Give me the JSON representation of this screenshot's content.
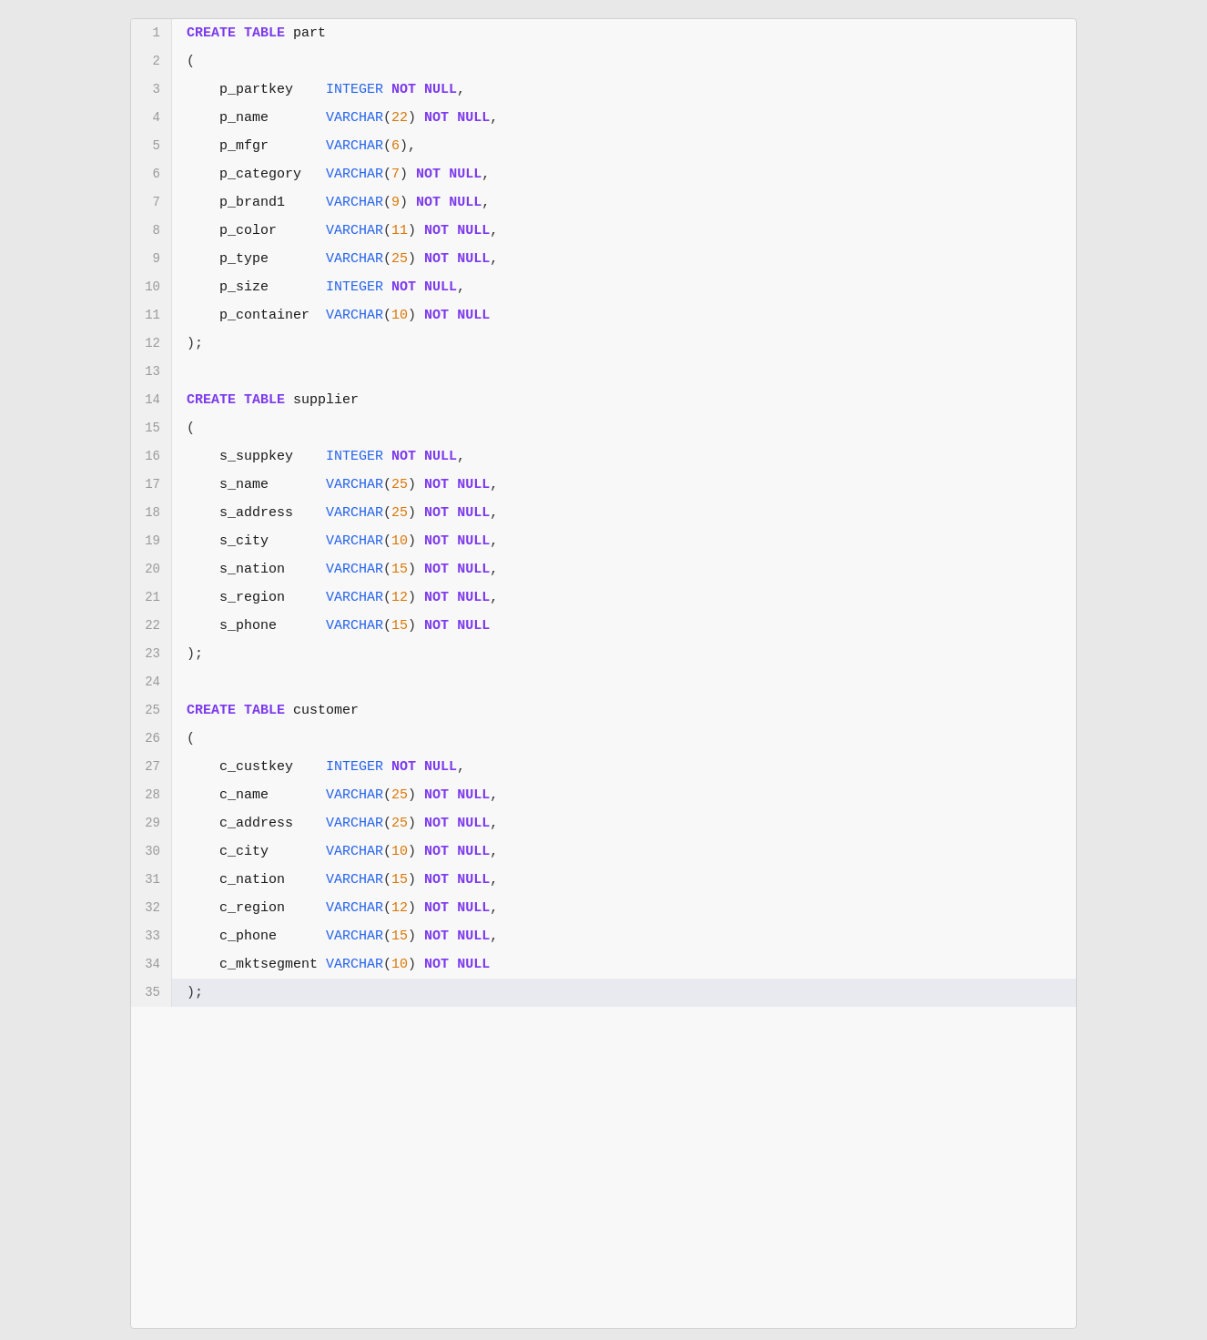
{
  "editor": {
    "lines": [
      {
        "num": 1,
        "tokens": [
          {
            "t": "CREATE",
            "cls": "kw-create"
          },
          {
            "t": " "
          },
          {
            "t": "TABLE",
            "cls": "kw-table"
          },
          {
            "t": " "
          },
          {
            "t": "part",
            "cls": "tbl-name"
          }
        ]
      },
      {
        "num": 2,
        "tokens": [
          {
            "t": "("
          }
        ]
      },
      {
        "num": 3,
        "tokens": [
          {
            "t": "    p_partkey    ",
            "cls": "col-name"
          },
          {
            "t": "INTEGER",
            "cls": "kw-integer"
          },
          {
            "t": " "
          },
          {
            "t": "NOT",
            "cls": "kw-not"
          },
          {
            "t": " "
          },
          {
            "t": "NULL",
            "cls": "kw-null"
          },
          {
            "t": ","
          }
        ]
      },
      {
        "num": 4,
        "tokens": [
          {
            "t": "    p_name       ",
            "cls": "col-name"
          },
          {
            "t": "VARCHAR",
            "cls": "kw-varchar"
          },
          {
            "t": "("
          },
          {
            "t": "22",
            "cls": "number"
          },
          {
            "t": ")"
          },
          {
            "t": " "
          },
          {
            "t": "NOT",
            "cls": "kw-not"
          },
          {
            "t": " "
          },
          {
            "t": "NULL",
            "cls": "kw-null"
          },
          {
            "t": ","
          }
        ]
      },
      {
        "num": 5,
        "tokens": [
          {
            "t": "    p_mfgr       ",
            "cls": "col-name"
          },
          {
            "t": "VARCHAR",
            "cls": "kw-varchar"
          },
          {
            "t": "("
          },
          {
            "t": "6",
            "cls": "number"
          },
          {
            "t": ")"
          },
          {
            "t": ","
          }
        ]
      },
      {
        "num": 6,
        "tokens": [
          {
            "t": "    p_category   ",
            "cls": "col-name"
          },
          {
            "t": "VARCHAR",
            "cls": "kw-varchar"
          },
          {
            "t": "("
          },
          {
            "t": "7",
            "cls": "number"
          },
          {
            "t": ")"
          },
          {
            "t": " "
          },
          {
            "t": "NOT",
            "cls": "kw-not"
          },
          {
            "t": " "
          },
          {
            "t": "NULL",
            "cls": "kw-null"
          },
          {
            "t": ","
          }
        ]
      },
      {
        "num": 7,
        "tokens": [
          {
            "t": "    p_brand1     ",
            "cls": "col-name"
          },
          {
            "t": "VARCHAR",
            "cls": "kw-varchar"
          },
          {
            "t": "("
          },
          {
            "t": "9",
            "cls": "number"
          },
          {
            "t": ")"
          },
          {
            "t": " "
          },
          {
            "t": "NOT",
            "cls": "kw-not"
          },
          {
            "t": " "
          },
          {
            "t": "NULL",
            "cls": "kw-null"
          },
          {
            "t": ","
          }
        ]
      },
      {
        "num": 8,
        "tokens": [
          {
            "t": "    p_color      ",
            "cls": "col-name"
          },
          {
            "t": "VARCHAR",
            "cls": "kw-varchar"
          },
          {
            "t": "("
          },
          {
            "t": "11",
            "cls": "number"
          },
          {
            "t": ")"
          },
          {
            "t": " "
          },
          {
            "t": "NOT",
            "cls": "kw-not"
          },
          {
            "t": " "
          },
          {
            "t": "NULL",
            "cls": "kw-null"
          },
          {
            "t": ","
          }
        ]
      },
      {
        "num": 9,
        "tokens": [
          {
            "t": "    p_type       ",
            "cls": "col-name"
          },
          {
            "t": "VARCHAR",
            "cls": "kw-varchar"
          },
          {
            "t": "("
          },
          {
            "t": "25",
            "cls": "number"
          },
          {
            "t": ")"
          },
          {
            "t": " "
          },
          {
            "t": "NOT",
            "cls": "kw-not"
          },
          {
            "t": " "
          },
          {
            "t": "NULL",
            "cls": "kw-null"
          },
          {
            "t": ","
          }
        ]
      },
      {
        "num": 10,
        "tokens": [
          {
            "t": "    p_size       ",
            "cls": "col-name"
          },
          {
            "t": "INTEGER",
            "cls": "kw-integer"
          },
          {
            "t": " "
          },
          {
            "t": "NOT",
            "cls": "kw-not"
          },
          {
            "t": " "
          },
          {
            "t": "NULL",
            "cls": "kw-null"
          },
          {
            "t": ","
          }
        ]
      },
      {
        "num": 11,
        "tokens": [
          {
            "t": "    p_container  ",
            "cls": "col-name"
          },
          {
            "t": "VARCHAR",
            "cls": "kw-varchar"
          },
          {
            "t": "("
          },
          {
            "t": "10",
            "cls": "number"
          },
          {
            "t": ")"
          },
          {
            "t": " "
          },
          {
            "t": "NOT",
            "cls": "kw-not"
          },
          {
            "t": " "
          },
          {
            "t": "NULL",
            "cls": "kw-null"
          }
        ]
      },
      {
        "num": 12,
        "tokens": [
          {
            "t": ")"
          },
          {
            "t": ";"
          }
        ]
      },
      {
        "num": 13,
        "tokens": []
      },
      {
        "num": 14,
        "tokens": [
          {
            "t": "CREATE",
            "cls": "kw-create"
          },
          {
            "t": " "
          },
          {
            "t": "TABLE",
            "cls": "kw-table"
          },
          {
            "t": " "
          },
          {
            "t": "supplier",
            "cls": "tbl-name"
          }
        ]
      },
      {
        "num": 15,
        "tokens": [
          {
            "t": "("
          }
        ]
      },
      {
        "num": 16,
        "tokens": [
          {
            "t": "    s_suppkey    ",
            "cls": "col-name"
          },
          {
            "t": "INTEGER",
            "cls": "kw-integer"
          },
          {
            "t": " "
          },
          {
            "t": "NOT",
            "cls": "kw-not"
          },
          {
            "t": " "
          },
          {
            "t": "NULL",
            "cls": "kw-null"
          },
          {
            "t": ","
          }
        ]
      },
      {
        "num": 17,
        "tokens": [
          {
            "t": "    s_name       ",
            "cls": "col-name"
          },
          {
            "t": "VARCHAR",
            "cls": "kw-varchar"
          },
          {
            "t": "("
          },
          {
            "t": "25",
            "cls": "number"
          },
          {
            "t": ")"
          },
          {
            "t": " "
          },
          {
            "t": "NOT",
            "cls": "kw-not"
          },
          {
            "t": " "
          },
          {
            "t": "NULL",
            "cls": "kw-null"
          },
          {
            "t": ","
          }
        ]
      },
      {
        "num": 18,
        "tokens": [
          {
            "t": "    s_address    ",
            "cls": "col-name"
          },
          {
            "t": "VARCHAR",
            "cls": "kw-varchar"
          },
          {
            "t": "("
          },
          {
            "t": "25",
            "cls": "number"
          },
          {
            "t": ")"
          },
          {
            "t": " "
          },
          {
            "t": "NOT",
            "cls": "kw-not"
          },
          {
            "t": " "
          },
          {
            "t": "NULL",
            "cls": "kw-null"
          },
          {
            "t": ","
          }
        ]
      },
      {
        "num": 19,
        "tokens": [
          {
            "t": "    s_city       ",
            "cls": "col-name"
          },
          {
            "t": "VARCHAR",
            "cls": "kw-varchar"
          },
          {
            "t": "("
          },
          {
            "t": "10",
            "cls": "number"
          },
          {
            "t": ")"
          },
          {
            "t": " "
          },
          {
            "t": "NOT",
            "cls": "kw-not"
          },
          {
            "t": " "
          },
          {
            "t": "NULL",
            "cls": "kw-null"
          },
          {
            "t": ","
          }
        ]
      },
      {
        "num": 20,
        "tokens": [
          {
            "t": "    s_nation     ",
            "cls": "col-name"
          },
          {
            "t": "VARCHAR",
            "cls": "kw-varchar"
          },
          {
            "t": "("
          },
          {
            "t": "15",
            "cls": "number"
          },
          {
            "t": ")"
          },
          {
            "t": " "
          },
          {
            "t": "NOT",
            "cls": "kw-not"
          },
          {
            "t": " "
          },
          {
            "t": "NULL",
            "cls": "kw-null"
          },
          {
            "t": ","
          }
        ]
      },
      {
        "num": 21,
        "tokens": [
          {
            "t": "    s_region     ",
            "cls": "col-name"
          },
          {
            "t": "VARCHAR",
            "cls": "kw-varchar"
          },
          {
            "t": "("
          },
          {
            "t": "12",
            "cls": "number"
          },
          {
            "t": ")"
          },
          {
            "t": " "
          },
          {
            "t": "NOT",
            "cls": "kw-not"
          },
          {
            "t": " "
          },
          {
            "t": "NULL",
            "cls": "kw-null"
          },
          {
            "t": ","
          }
        ]
      },
      {
        "num": 22,
        "tokens": [
          {
            "t": "    s_phone      ",
            "cls": "col-name"
          },
          {
            "t": "VARCHAR",
            "cls": "kw-varchar"
          },
          {
            "t": "("
          },
          {
            "t": "15",
            "cls": "number"
          },
          {
            "t": ")"
          },
          {
            "t": " "
          },
          {
            "t": "NOT",
            "cls": "kw-not"
          },
          {
            "t": " "
          },
          {
            "t": "NULL",
            "cls": "kw-null"
          }
        ]
      },
      {
        "num": 23,
        "tokens": [
          {
            "t": ")"
          },
          {
            "t": ";"
          }
        ]
      },
      {
        "num": 24,
        "tokens": []
      },
      {
        "num": 25,
        "tokens": [
          {
            "t": "CREATE",
            "cls": "kw-create"
          },
          {
            "t": " "
          },
          {
            "t": "TABLE",
            "cls": "kw-table"
          },
          {
            "t": " "
          },
          {
            "t": "customer",
            "cls": "tbl-name"
          }
        ]
      },
      {
        "num": 26,
        "tokens": [
          {
            "t": "("
          }
        ]
      },
      {
        "num": 27,
        "tokens": [
          {
            "t": "    c_custkey    ",
            "cls": "col-name"
          },
          {
            "t": "INTEGER",
            "cls": "kw-integer"
          },
          {
            "t": " "
          },
          {
            "t": "NOT",
            "cls": "kw-not"
          },
          {
            "t": " "
          },
          {
            "t": "NULL",
            "cls": "kw-null"
          },
          {
            "t": ","
          }
        ]
      },
      {
        "num": 28,
        "tokens": [
          {
            "t": "    c_name       ",
            "cls": "col-name"
          },
          {
            "t": "VARCHAR",
            "cls": "kw-varchar"
          },
          {
            "t": "("
          },
          {
            "t": "25",
            "cls": "number"
          },
          {
            "t": ")"
          },
          {
            "t": " "
          },
          {
            "t": "NOT",
            "cls": "kw-not"
          },
          {
            "t": " "
          },
          {
            "t": "NULL",
            "cls": "kw-null"
          },
          {
            "t": ","
          }
        ]
      },
      {
        "num": 29,
        "tokens": [
          {
            "t": "    c_address    ",
            "cls": "col-name"
          },
          {
            "t": "VARCHAR",
            "cls": "kw-varchar"
          },
          {
            "t": "("
          },
          {
            "t": "25",
            "cls": "number"
          },
          {
            "t": ")"
          },
          {
            "t": " "
          },
          {
            "t": "NOT",
            "cls": "kw-not"
          },
          {
            "t": " "
          },
          {
            "t": "NULL",
            "cls": "kw-null"
          },
          {
            "t": ","
          }
        ]
      },
      {
        "num": 30,
        "tokens": [
          {
            "t": "    c_city       ",
            "cls": "col-name"
          },
          {
            "t": "VARCHAR",
            "cls": "kw-varchar"
          },
          {
            "t": "("
          },
          {
            "t": "10",
            "cls": "number"
          },
          {
            "t": ")"
          },
          {
            "t": " "
          },
          {
            "t": "NOT",
            "cls": "kw-not"
          },
          {
            "t": " "
          },
          {
            "t": "NULL",
            "cls": "kw-null"
          },
          {
            "t": ","
          }
        ]
      },
      {
        "num": 31,
        "tokens": [
          {
            "t": "    c_nation     ",
            "cls": "col-name"
          },
          {
            "t": "VARCHAR",
            "cls": "kw-varchar"
          },
          {
            "t": "("
          },
          {
            "t": "15",
            "cls": "number"
          },
          {
            "t": ")"
          },
          {
            "t": " "
          },
          {
            "t": "NOT",
            "cls": "kw-not"
          },
          {
            "t": " "
          },
          {
            "t": "NULL",
            "cls": "kw-null"
          },
          {
            "t": ","
          }
        ]
      },
      {
        "num": 32,
        "tokens": [
          {
            "t": "    c_region     ",
            "cls": "col-name"
          },
          {
            "t": "VARCHAR",
            "cls": "kw-varchar"
          },
          {
            "t": "("
          },
          {
            "t": "12",
            "cls": "number"
          },
          {
            "t": ")"
          },
          {
            "t": " "
          },
          {
            "t": "NOT",
            "cls": "kw-not"
          },
          {
            "t": " "
          },
          {
            "t": "NULL",
            "cls": "kw-null"
          },
          {
            "t": ","
          }
        ]
      },
      {
        "num": 33,
        "tokens": [
          {
            "t": "    c_phone      ",
            "cls": "col-name"
          },
          {
            "t": "VARCHAR",
            "cls": "kw-varchar"
          },
          {
            "t": "("
          },
          {
            "t": "15",
            "cls": "number"
          },
          {
            "t": ")"
          },
          {
            "t": " "
          },
          {
            "t": "NOT",
            "cls": "kw-not"
          },
          {
            "t": " "
          },
          {
            "t": "NULL",
            "cls": "kw-null"
          },
          {
            "t": ","
          }
        ]
      },
      {
        "num": 34,
        "tokens": [
          {
            "t": "    c_mktsegment ",
            "cls": "col-name"
          },
          {
            "t": "VARCHAR",
            "cls": "kw-varchar"
          },
          {
            "t": "("
          },
          {
            "t": "10",
            "cls": "number"
          },
          {
            "t": ")"
          },
          {
            "t": " "
          },
          {
            "t": "NOT",
            "cls": "kw-not"
          },
          {
            "t": " "
          },
          {
            "t": "NULL",
            "cls": "kw-null"
          }
        ]
      },
      {
        "num": 35,
        "tokens": [
          {
            "t": ")"
          },
          {
            "t": ";"
          }
        ],
        "highlight": true
      }
    ]
  }
}
